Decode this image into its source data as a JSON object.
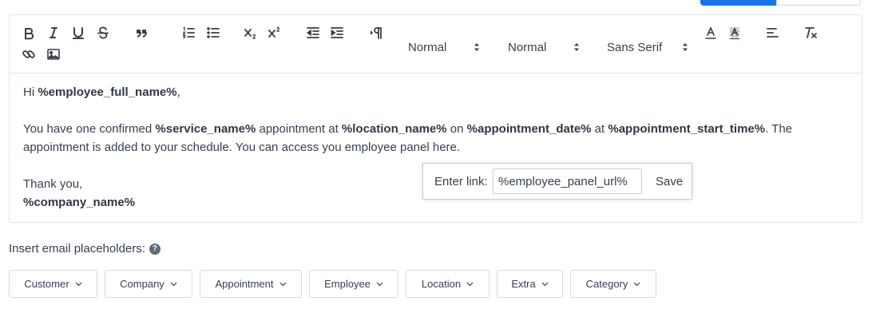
{
  "toolbar": {
    "header_select": "Normal",
    "size_select": "Normal",
    "font_select": "Sans Serif"
  },
  "content": {
    "greeting_prefix": "Hi ",
    "employee_full_name": "%employee_full_name%",
    "greeting_suffix": ",",
    "line1_a": "You have one confirmed ",
    "service_name": "%service_name%",
    "line1_b": " appointment at ",
    "location_name": "%location_name%",
    "line1_c": " on ",
    "appointment_date": "%appointment_date%",
    "line1_d": " at ",
    "appointment_start_time": "%appointment_start_time%",
    "line1_e": ". The appointment is added to your schedule. You can access you employee panel here.",
    "thanks": "Thank you,",
    "company_name": "%company_name%"
  },
  "link_tooltip": {
    "label": "Enter link:",
    "value": "%employee_panel_url%",
    "save_label": "Save"
  },
  "placeholders": {
    "label": "Insert email placeholders:",
    "help_glyph": "?",
    "buttons": [
      "Customer",
      "Company",
      "Appointment",
      "Employee",
      "Location",
      "Extra",
      "Category"
    ]
  },
  "colors": {
    "accent": "#1a73e8",
    "text": "#354052",
    "border": "#e3e5ea"
  }
}
